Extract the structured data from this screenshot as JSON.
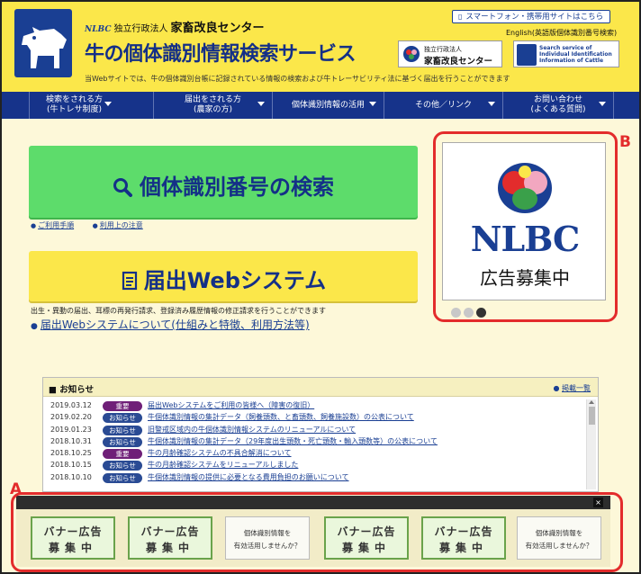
{
  "header": {
    "org_type": "独立行政法人",
    "org_name": "家畜改良センター",
    "org_mark": "NLBC",
    "site_title": "牛の個体識別情報検索サービス",
    "description": "当Webサイトでは、牛の個体識別台帳に記録されている情報の検索および牛トレーサビリティ法に基づく届出を行うことができます",
    "mobile_link": "スマートフォン・携帯用サイトはこちら",
    "english_link": "English(英語版個体識別番号検索)",
    "badge_nlbc": {
      "line1": "独立行政法人",
      "line2": "家畜改良センター"
    },
    "badge_english": "Search service of Individual Identification Information of Cattle"
  },
  "nav": {
    "items": [
      {
        "label": "検索をされる方",
        "sub": "(牛トレサ制度)"
      },
      {
        "label": "届出をされる方",
        "sub": "(農家の方)"
      },
      {
        "label": "個体識別情報の活用",
        "sub": ""
      },
      {
        "label": "その他／リンク",
        "sub": ""
      },
      {
        "label": "お問い合わせ",
        "sub": "(よくある質問)"
      }
    ]
  },
  "main": {
    "search_button": "個体識別番号の検索",
    "links": [
      "ご利用手順",
      "利用上の注意"
    ],
    "todoke_button": "届出Webシステム",
    "todoke_desc": "出生・異動の届出、耳標の再発行請求、登録済み履歴情報の修正請求を行うことができます",
    "todoke_about": "届出Webシステムについて(仕組みと特徴、利用方法等)"
  },
  "ad": {
    "logo_text": "NLBC",
    "recruit": "広告募集中",
    "dots": 3,
    "active_dot": 2
  },
  "news": {
    "title": "お知らせ",
    "all_link": "掲載一覧",
    "items": [
      {
        "date": "2019.03.12",
        "badge": "重要",
        "kind": "imp",
        "text": "届出Webシステムをご利用の皆様へ（障害の復旧）"
      },
      {
        "date": "2019.02.20",
        "badge": "お知らせ",
        "kind": "inf",
        "text": "牛個体識別情報の集計データ（飼養頭数、と畜頭数、飼養施設数）の公表について"
      },
      {
        "date": "2019.01.23",
        "badge": "お知らせ",
        "kind": "inf",
        "text": "旧警戒区域内の牛個体識別情報システムのリニューアルについて"
      },
      {
        "date": "2018.10.31",
        "badge": "お知らせ",
        "kind": "inf",
        "text": "牛個体識別情報の集計データ（29年度出生頭数・死亡頭数・輸入頭数等）の公表について"
      },
      {
        "date": "2018.10.25",
        "badge": "重要",
        "kind": "imp",
        "text": "牛の月齢確認システムの不具合解消について"
      },
      {
        "date": "2018.10.15",
        "badge": "お知らせ",
        "kind": "inf",
        "text": "牛の月齢確認システムをリニューアルしました"
      },
      {
        "date": "2018.10.10",
        "badge": "お知らせ",
        "kind": "inf",
        "text": "牛個体識別情報の提供に必要となる費用負担のお願いについて"
      }
    ]
  },
  "banners": [
    {
      "type": "ad",
      "line1": "バナー広告",
      "line2": "募集中"
    },
    {
      "type": "ad",
      "line1": "バナー広告",
      "line2": "募集中"
    },
    {
      "type": "info",
      "line1": "個体識別情報を",
      "line2": "有効活用しませんか？"
    },
    {
      "type": "ad",
      "line1": "バナー広告",
      "line2": "募集中"
    },
    {
      "type": "ad",
      "line1": "バナー広告",
      "line2": "募集中"
    },
    {
      "type": "info",
      "line1": "個体識別情報を",
      "line2": "有効活用しませんか？"
    }
  ],
  "annotations": {
    "a": "A",
    "b": "B"
  },
  "colors": {
    "accent_red": "#e32c2c",
    "navy": "#16338a",
    "header_yellow": "#fbe74a",
    "search_green": "#5ddc6b"
  }
}
